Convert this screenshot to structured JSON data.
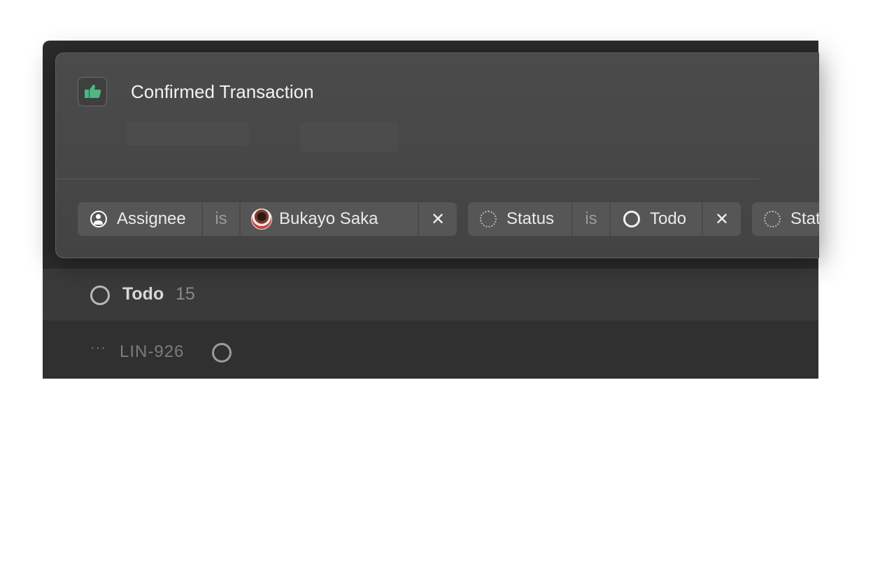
{
  "view": {
    "title": "Confirmed Transaction",
    "icon": "thumbs-up-icon",
    "icon_color": "#4cb782"
  },
  "filters": [
    {
      "field": "Assignee",
      "field_icon": "assignee-icon",
      "operator": "is",
      "value": "Bukayo Saka",
      "value_icon": "avatar",
      "remove_label": "✕"
    },
    {
      "field": "Status",
      "field_icon": "status-icon",
      "operator": "is",
      "value": "Todo",
      "value_icon": "todo-circle-icon",
      "remove_label": "✕"
    },
    {
      "field": "Stat",
      "field_icon": "status-icon"
    }
  ],
  "list": {
    "group_label": "Todo",
    "group_count": "15",
    "rows": [
      {
        "more": "···",
        "id": "LIN-926",
        "status_icon": "todo-circle-icon"
      }
    ]
  }
}
